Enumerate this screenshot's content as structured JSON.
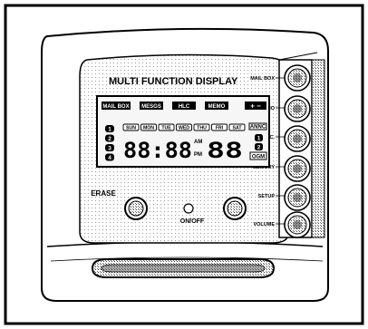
{
  "title": "MULTI FUNCTION DISPLAY",
  "mode_buttons": [
    "MAIL BOX",
    "MESGS",
    "HLC",
    "MEMO"
  ],
  "plus_minus": "+ −",
  "days": [
    "SUN",
    "MON",
    "TUE",
    "WED",
    "THU",
    "FRI",
    "SAT"
  ],
  "annc": "ANNC",
  "left_numbers": [
    "1",
    "2",
    "3",
    "4"
  ],
  "right_numbers": [
    "1",
    "2"
  ],
  "time": "88:88",
  "am": "AM",
  "pm": "PM",
  "small_digits": "88",
  "ogm": "OGM",
  "erase": "ERASE",
  "onoff": "ON/OFF",
  "side_labels": [
    "MAIL BOX",
    "MEMO",
    "ANNC.",
    "MEMORY",
    "SETUP",
    "VOLUME"
  ],
  "colors": {
    "ink": "#000000",
    "panel": "#ffffff",
    "lcd": "#f6f6f6"
  }
}
